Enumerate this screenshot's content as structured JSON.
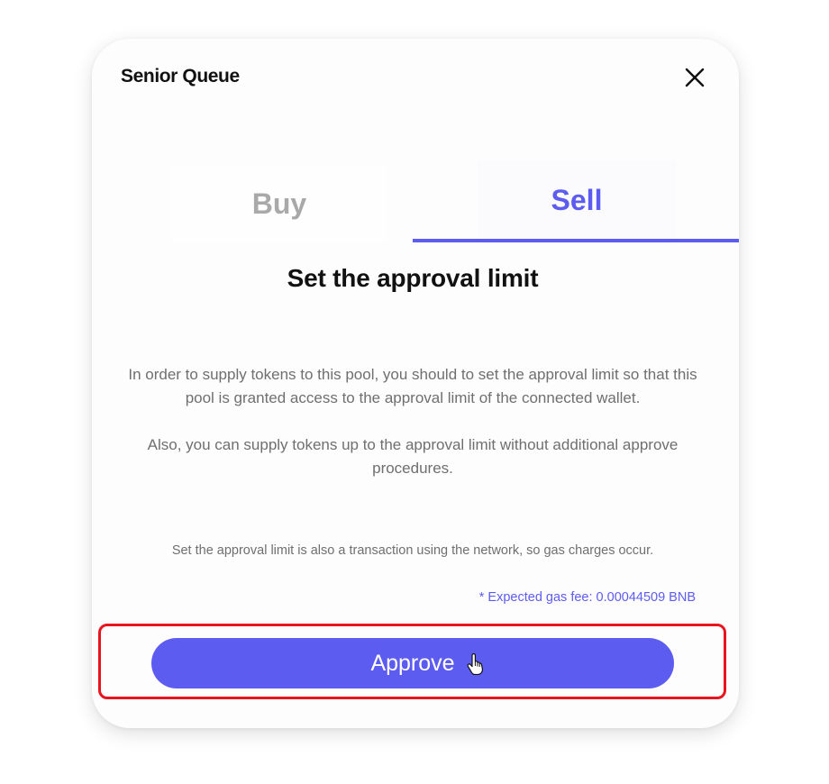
{
  "modal": {
    "title": "Senior Queue",
    "close_icon": "close-icon"
  },
  "tabs": [
    {
      "label": "Buy",
      "active": false
    },
    {
      "label": "Sell",
      "active": true
    }
  ],
  "content": {
    "heading": "Set the approval limit",
    "description_1": "In order to supply tokens to this pool, you should to set the approval limit so that this pool is granted access to the approval limit of the connected wallet.",
    "description_2": "Also, you can supply tokens up to the approval limit without additional approve procedures.",
    "gas_note": "Set the approval limit is also a transaction using the network, so gas charges occur.",
    "gas_fee": "* Expected gas fee: 0.00044509 BNB"
  },
  "actions": {
    "approve_label": "Approve",
    "cursor_icon": "hand-pointer-icon"
  },
  "colors": {
    "accent": "#5d5cf1",
    "highlight": "#e8151e",
    "inactive_tab": "#a9a9a9",
    "body_text": "#6f6f6f"
  }
}
